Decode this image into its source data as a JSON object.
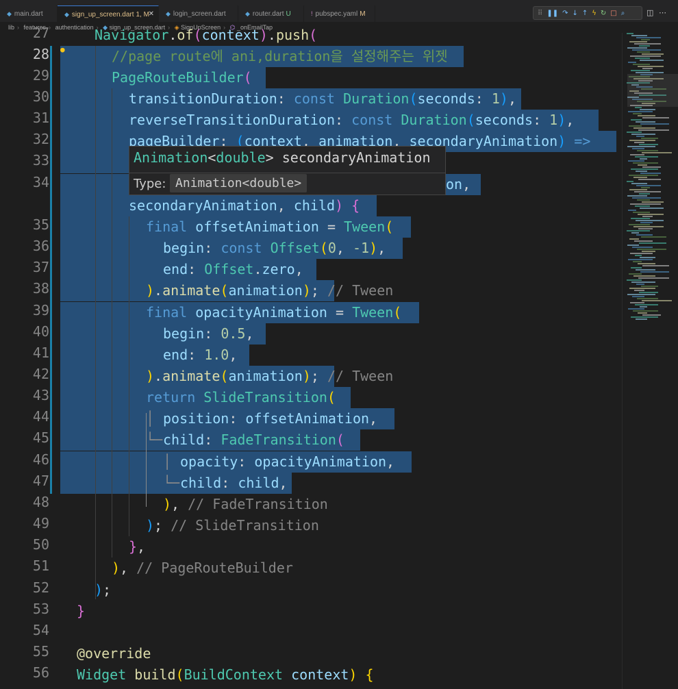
{
  "tabs": [
    {
      "name": "main.dart",
      "status": ""
    },
    {
      "name": "sign_up_screen.dart",
      "status": "1, M"
    },
    {
      "name": "login_screen.dart",
      "status": ""
    },
    {
      "name": "router.dart",
      "status": "U"
    },
    {
      "name": "pubspec.yaml",
      "status": "M"
    }
  ],
  "breadcrumb": [
    "lib",
    "features",
    "authentication",
    "sign_up_screen.dart",
    "SignUpScreen",
    "_onEmailTap"
  ],
  "hover": {
    "signature": "Animation<double> secondaryAnimation",
    "type_label": "Type:",
    "type_value": "Animation<double>"
  },
  "colors": {
    "keyword": "#569cd6",
    "comment": "#6a9955",
    "type": "#4ec9b0",
    "function": "#dcdcaa",
    "variable": "#9cdcfe",
    "number": "#b5cea8",
    "selection": "#264f78",
    "bracket1": "#ffd700",
    "bracket2": "#da70d6",
    "bracket3": "#179fff"
  },
  "lines": [
    {
      "num": "27",
      "text": "Navigator.of(context).push("
    },
    {
      "num": "28",
      "text": "//page route에 ani,duration을 설정해주는 위젯"
    },
    {
      "num": "29",
      "text": "PageRouteBuilder("
    },
    {
      "num": "30",
      "text": "transitionDuration: const Duration(seconds: 1),"
    },
    {
      "num": "31",
      "text": "reverseTransitionDuration: const Duration(seconds: 1),"
    },
    {
      "num": "32",
      "text": "pageBuilder: (context, animation, secondaryAnimation) =>"
    },
    {
      "num": "33",
      "text": ""
    },
    {
      "num": "34",
      "text": "on,"
    },
    {
      "num": "",
      "text": "secondaryAnimation, child) {"
    },
    {
      "num": "35",
      "text": "final offsetAnimation = Tween("
    },
    {
      "num": "36",
      "text": "begin: const Offset(0, -1),"
    },
    {
      "num": "37",
      "text": "end: Offset.zero,"
    },
    {
      "num": "38",
      "text": ").animate(animation); // Tween"
    },
    {
      "num": "39",
      "text": "final opacityAnimation = Tween("
    },
    {
      "num": "40",
      "text": "begin: 0.5,"
    },
    {
      "num": "41",
      "text": "end: 1.0,"
    },
    {
      "num": "42",
      "text": ").animate(animation); // Tween"
    },
    {
      "num": "43",
      "text": "return SlideTransition("
    },
    {
      "num": "44",
      "text": "position: offsetAnimation,"
    },
    {
      "num": "45",
      "text": "child: FadeTransition("
    },
    {
      "num": "46",
      "text": "opacity: opacityAnimation,"
    },
    {
      "num": "47",
      "text": "child: child,"
    },
    {
      "num": "48",
      "text": "), // FadeTransition"
    },
    {
      "num": "49",
      "text": "); // SlideTransition"
    },
    {
      "num": "50",
      "text": "},"
    },
    {
      "num": "51",
      "text": "), // PageRouteBuilder"
    },
    {
      "num": "52",
      "text": ");"
    },
    {
      "num": "53",
      "text": "}"
    },
    {
      "num": "54",
      "text": ""
    },
    {
      "num": "55",
      "text": "@override"
    },
    {
      "num": "56",
      "text": "Widget build(BuildContext context) {"
    }
  ]
}
